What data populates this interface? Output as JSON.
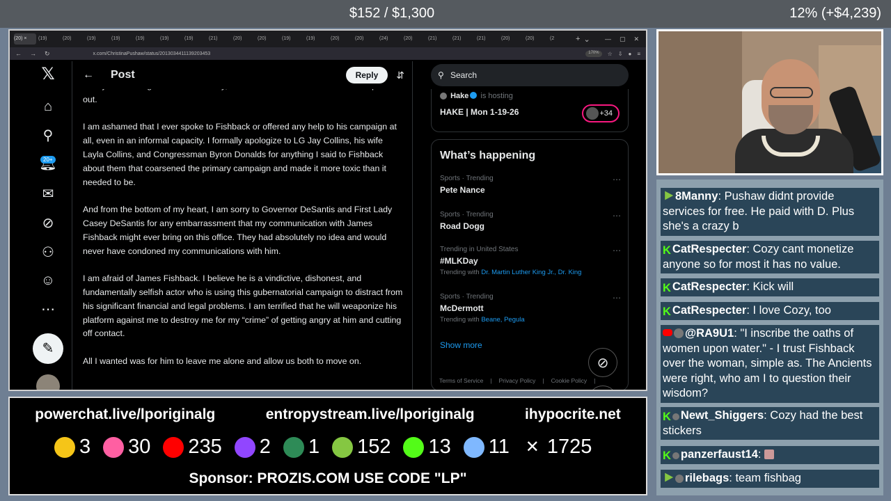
{
  "overlay": {
    "goal": "$152 / $1,300",
    "percent": "12% (+$4,239)"
  },
  "browser": {
    "tabs": [
      "(20) ×",
      "(19)",
      "(20)",
      "(19)",
      "(19)",
      "(19)",
      "(19)",
      "(19)",
      "(21)",
      "(20)",
      "(20)",
      "(19)",
      "(19)",
      "(20)",
      "(20)",
      "(24)",
      "(20)",
      "(21)",
      "(21)",
      "(21)",
      "(20)",
      "(20)",
      "(2"
    ],
    "url": "x.com/ChristinaPushaw/status/2013034411139203453",
    "zoom": "170%"
  },
  "x": {
    "nav_badge": "20+",
    "header": {
      "title": "Post",
      "reply": "Reply"
    },
    "post_paragraphs": [
      "but by threatening to smear me today, he has left me with no choice but to speak out.",
      "I am ashamed that I ever spoke to Fishback or offered any help to his campaign at all, even in an informal capacity. I formally apologize to LG Jay Collins, his wife Layla Collins, and Congressman Byron Donalds for anything I said to Fishback about them that coarsened the primary campaign and made it more toxic than it needed to be.",
      "And from the bottom of my heart, I am sorry to Governor DeSantis and First Lady Casey DeSantis for any embarrassment that my communication with James Fishback might ever bring on this office. They had absolutely no idea and would never have condoned my communications with him.",
      "I am afraid of James Fishback. I believe he is a vindictive, dishonest, and fundamentally selfish actor who is using this gubernatorial campaign to distract from his significant financial and legal problems. I am terrified that he will weaponize his platform against me to destroy me for my “crime” of getting angry at him and cutting off contact.",
      "All I wanted was for him to leave me alone and allow us both to move on."
    ],
    "search_placeholder": "Search",
    "host": {
      "name": "Hake",
      "action": "is hosting",
      "title": "HAKE | Mon 1-19-26",
      "count": "+34"
    },
    "happening_title": "What’s happening",
    "trends": [
      {
        "meta": "Sports · Trending",
        "name": "Pete Nance",
        "with_label": "",
        "with": ""
      },
      {
        "meta": "Sports · Trending",
        "name": "Road Dogg",
        "with_label": "",
        "with": ""
      },
      {
        "meta": "Trending in United States",
        "name": "#MLKDay",
        "with_label": "Trending with",
        "with": "Dr. Martin Luther King Jr., Dr. King"
      },
      {
        "meta": "Sports · Trending",
        "name": "McDermott",
        "with_label": "Trending with",
        "with": "Beane, Pegula"
      }
    ],
    "show_more": "Show more",
    "footer": [
      "Terms of Service",
      "|",
      "Privacy Policy",
      "|",
      "Cookie Policy",
      "|"
    ]
  },
  "chat": [
    {
      "platform": "rumble",
      "user": "8Manny",
      "text": ": Pushaw didnt provide services for free. He paid with D. Plus she's a crazy b"
    },
    {
      "platform": "kick",
      "user": "CatRespecter",
      "text": ": Cozy cant monetize anyone so for most it has no value."
    },
    {
      "platform": "kick",
      "user": "CatRespecter",
      "text": ": Kick will"
    },
    {
      "platform": "kick",
      "user": "CatRespecter",
      "text": ": I love Cozy, too"
    },
    {
      "platform": "youtube",
      "user": "@RA9U1",
      "text": ": \"I inscribe the oaths of women upon water.\" - I trust Fishback over the woman, simple as. The Ancients were right, who am I to question their wisdom?"
    },
    {
      "platform": "kick",
      "user": "Newt_Shiggers",
      "text": ": Cozy had the best stickers"
    },
    {
      "platform": "kick",
      "user": "panzerfaust14",
      "text": ":"
    },
    {
      "platform": "rumble",
      "user": "rilebags",
      "text": ": team fishbag"
    }
  ],
  "banner": {
    "links": [
      "powerchat.live/lporiginalg",
      "entropystream.live/lporiginalg",
      "ihypocrite.net"
    ],
    "counts": [
      {
        "icon": "pilled-icon",
        "color": "#f5c518",
        "value": "3"
      },
      {
        "icon": "entropy-icon",
        "color": "#ff5fa2",
        "value": "30"
      },
      {
        "icon": "youtube-icon",
        "color": "#ff0000",
        "value": "235"
      },
      {
        "icon": "twitch-icon",
        "color": "#9146ff",
        "value": "2"
      },
      {
        "icon": "orb-icon",
        "color": "#2e8b57",
        "value": "1"
      },
      {
        "icon": "rumble-icon",
        "color": "#85c742",
        "value": "152"
      },
      {
        "icon": "kick-icon",
        "color": "#53fc18",
        "value": "13"
      },
      {
        "icon": "moon-icon",
        "color": "#7fb8ff",
        "value": "11"
      },
      {
        "icon": "x-icon",
        "color": "#ffffff",
        "value": "1725"
      }
    ],
    "sponsor": "Sponsor: PROZIS.COM USE CODE \"LP\""
  }
}
